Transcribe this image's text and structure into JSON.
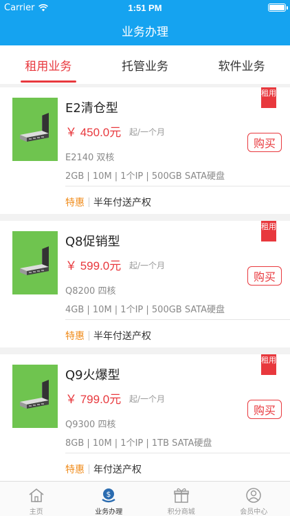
{
  "status_bar": {
    "carrier": "Carrier",
    "time": "1:51 PM"
  },
  "nav": {
    "title": "业务办理"
  },
  "tabs": [
    {
      "label": "租用业务",
      "active": true
    },
    {
      "label": "托管业务",
      "active": false
    },
    {
      "label": "软件业务",
      "active": false
    }
  ],
  "products": [
    {
      "name": "E2清仓型",
      "price": "￥ 450.0元",
      "unit": "起/一个月",
      "cpu": "E2140 双核",
      "specs": "2GB | 10M | 1个IP | 500GB  SATA硬盘",
      "promo_label": "特惠",
      "promo_text": "半年付送产权",
      "tag": "租用",
      "buy": "购买"
    },
    {
      "name": "Q8促销型",
      "price": "￥ 599.0元",
      "unit": "起/一个月",
      "cpu": "Q8200 四核",
      "specs": "4GB | 10M | 1个IP | 500GB  SATA硬盘",
      "promo_label": "特惠",
      "promo_text": "半年付送产权",
      "tag": "租用",
      "buy": "购买"
    },
    {
      "name": "Q9火爆型",
      "price": "￥ 799.0元",
      "unit": "起/一个月",
      "cpu": "Q9300 四核",
      "specs": "8GB | 10M | 1个IP | 1TB SATA硬盘",
      "promo_label": "特惠",
      "promo_text": "年付送产权",
      "tag": "租用",
      "buy": "购买"
    }
  ],
  "tab_bar": [
    {
      "label": "主页",
      "icon": "home-icon",
      "active": false
    },
    {
      "label": "业务办理",
      "icon": "money-bag-icon",
      "active": true
    },
    {
      "label": "积分商城",
      "icon": "gift-icon",
      "active": false
    },
    {
      "label": "会员中心",
      "icon": "user-icon",
      "active": false
    }
  ],
  "colors": {
    "primary": "#15a3f0",
    "accent": "#e8383d",
    "promo": "#f08c1c",
    "thumb": "#6fc44f"
  }
}
